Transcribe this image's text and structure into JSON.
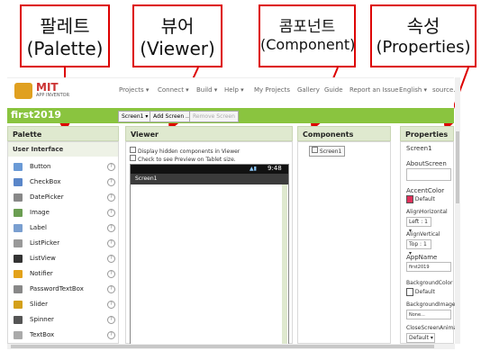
{
  "callouts": [
    {
      "korean": "팔레트",
      "english": "(Palette)"
    },
    {
      "korean": "뷰어",
      "english": "(Viewer)"
    },
    {
      "korean": "콤포넌트",
      "english": "(Component)"
    },
    {
      "korean": "속성",
      "english": "(Properties)"
    }
  ],
  "brand": {
    "logo_text": "MIT",
    "sub_text": "APP INVENTOR"
  },
  "top_menu": [
    "Projects ▾",
    "Connect ▾",
    "Build ▾",
    "Help ▾",
    "My Projects",
    "Gallery",
    "Guide",
    "Report an Issue",
    "English ▾",
    "source..."
  ],
  "project": {
    "name": "first2019",
    "screen_select": "Screen1 ▾",
    "add_screen": "Add Screen ...",
    "remove_screen": "Remove Screen"
  },
  "palette": {
    "title": "Palette",
    "category": "User Interface",
    "items": [
      {
        "label": "Button",
        "icon": "button-icon",
        "color": "#6a9ad6"
      },
      {
        "label": "CheckBox",
        "icon": "checkbox-icon",
        "color": "#5a86c9"
      },
      {
        "label": "DatePicker",
        "icon": "datepicker-icon",
        "color": "#888888"
      },
      {
        "label": "Image",
        "icon": "image-icon",
        "color": "#6b9e52"
      },
      {
        "label": "Label",
        "icon": "label-icon",
        "color": "#7a9fd0"
      },
      {
        "label": "ListPicker",
        "icon": "listpicker-icon",
        "color": "#999999"
      },
      {
        "label": "ListView",
        "icon": "listview-icon",
        "color": "#333333"
      },
      {
        "label": "Notifier",
        "icon": "notifier-icon",
        "color": "#e3a21a"
      },
      {
        "label": "PasswordTextBox",
        "icon": "password-icon",
        "color": "#888888"
      },
      {
        "label": "Slider",
        "icon": "slider-icon",
        "color": "#d4a01a"
      },
      {
        "label": "Spinner",
        "icon": "spinner-icon",
        "color": "#555555"
      },
      {
        "label": "TextBox",
        "icon": "textbox-icon",
        "color": "#aaaaaa"
      }
    ],
    "help": "?"
  },
  "viewer": {
    "title": "Viewer",
    "opt_hidden": "Display hidden components in Viewer",
    "opt_tablet": "Check to see Preview on Tablet size.",
    "status_time": "9:48",
    "screen_title": "Screen1"
  },
  "components": {
    "title": "Components",
    "root": "Screen1"
  },
  "properties": {
    "title": "Properties",
    "component": "Screen1",
    "about_label": "AboutScreen",
    "accent_label": "AccentColor",
    "accent_value": "Default",
    "accent_color": "#e0305a",
    "alignh_label": "AlignHorizontal",
    "alignh_value": "Left : 1 ▾",
    "alignv_label": "AlignVertical",
    "alignv_value": "Top : 1 ▾",
    "appname_label": "AppName",
    "appname_value": "first2019",
    "bgcolor_label": "BackgroundColor",
    "bgcolor_value": "Default",
    "bgimage_label": "BackgroundImage",
    "bgimage_value": "None...",
    "closeanim_label": "CloseScreenAnima",
    "closeanim_value": "Default ▾"
  }
}
